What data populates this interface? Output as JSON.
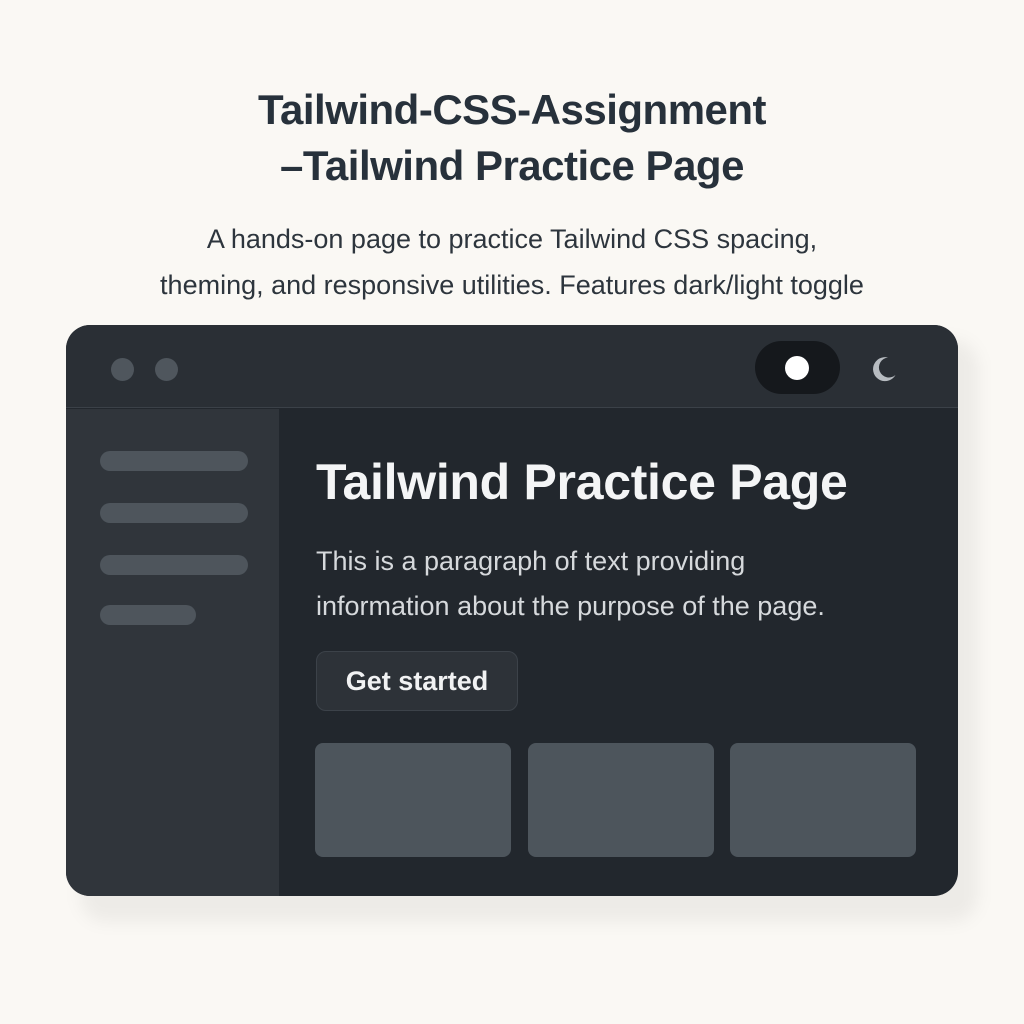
{
  "heading": {
    "title_line1": "Tailwind-CSS-Assignment",
    "title_line2": "–Tailwind Practice Page",
    "subtitle_line1": "A hands-on page to practice Tailwind CSS spacing,",
    "subtitle_line2": "theming, and responsive utilities. Features dark/light  toggle"
  },
  "window": {
    "theme_toggle": {
      "state": "dark",
      "icon": "moon-icon"
    },
    "window_controls": [
      "window-dot-icon",
      "window-dot-icon"
    ],
    "sidebar": {
      "item_count": 4
    },
    "main": {
      "title": "Tailwind Practice Page",
      "paragraph_line1": "This is a paragraph of text providing",
      "paragraph_line2": "information about the purpose of the page.",
      "cta_label": "Get started",
      "card_count": 3
    }
  },
  "colors": {
    "page_background": "#faf8f4",
    "window_background": "#22272d",
    "sidebar_background": "#30353b",
    "placeholder": "#4e555c",
    "text_dark": "#27313b",
    "text_light": "#f4f5f6"
  }
}
